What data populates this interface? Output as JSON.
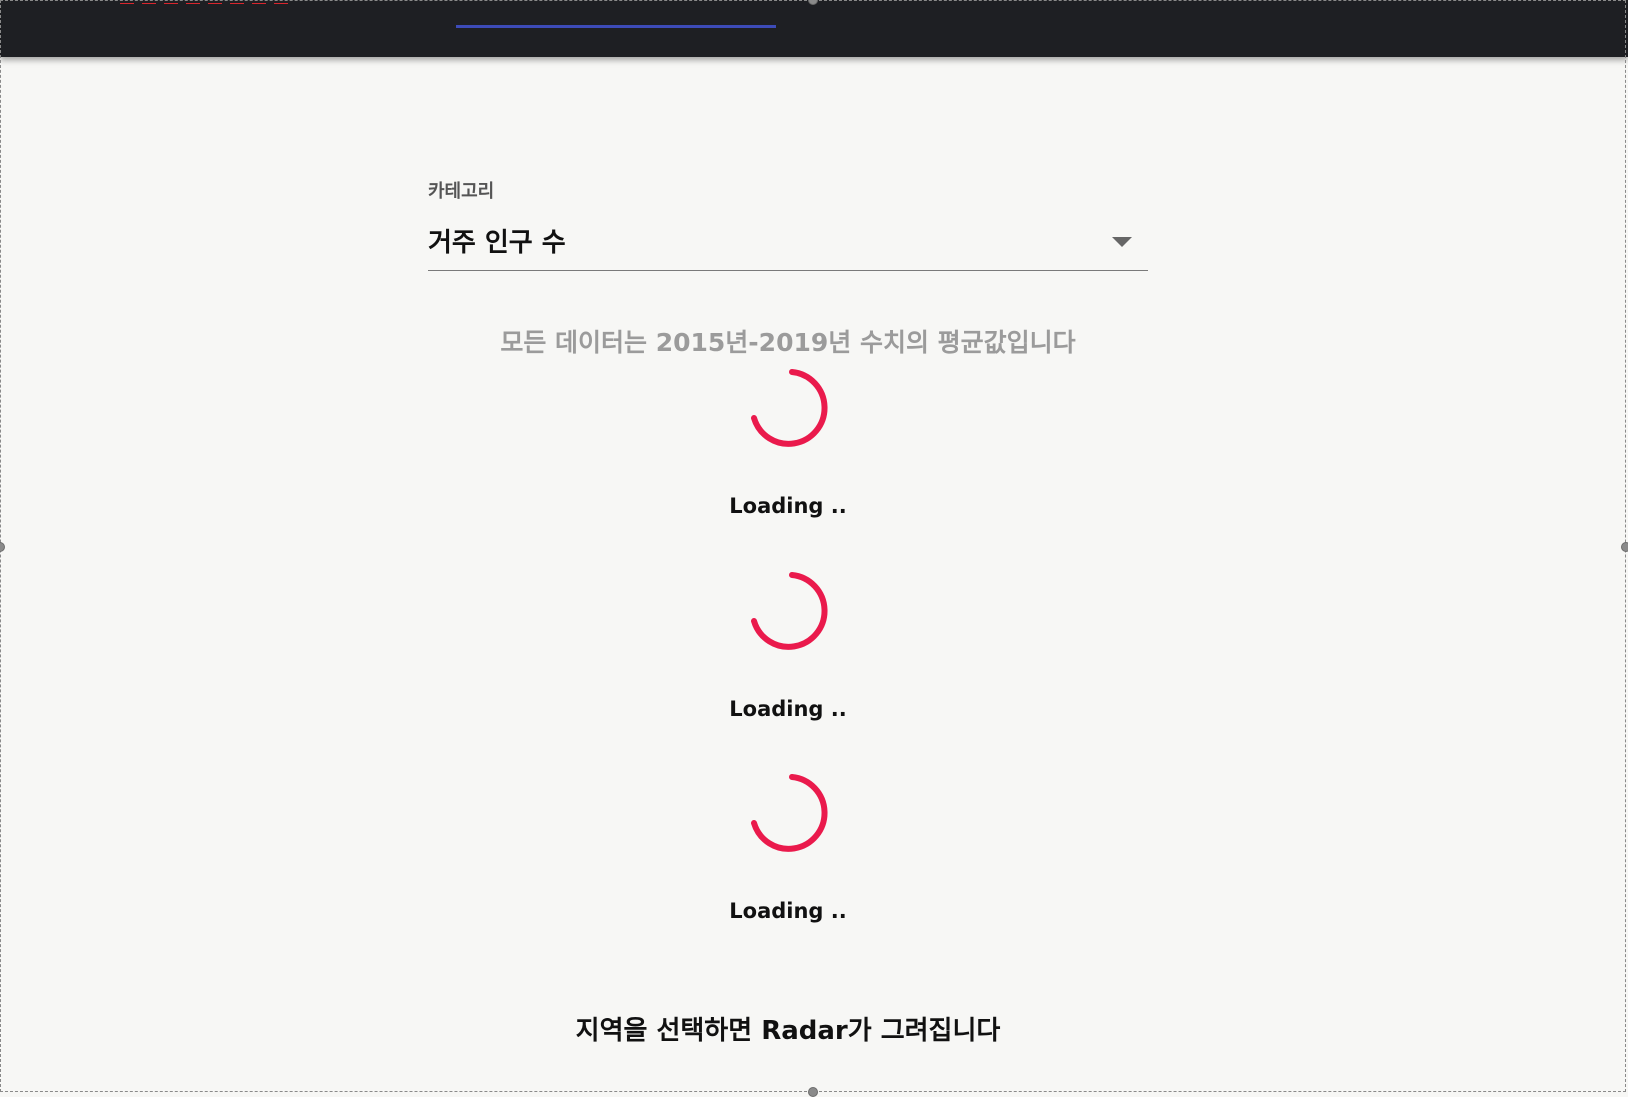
{
  "select": {
    "label": "카테고리",
    "value": "거주 인구 수"
  },
  "notice": "모든 데이터는 2015년-2019년 수치의 평균값입니다",
  "loaders": [
    {
      "text": "Loading .."
    },
    {
      "text": "Loading .."
    },
    {
      "text": "Loading .."
    }
  ],
  "radar_message": "지역을 선택하면 Radar가 그려집니다",
  "colors": {
    "spinner": "#ea1a4c",
    "topbar": "#1e1f23",
    "tab_indicator": "#3d4bb8"
  }
}
